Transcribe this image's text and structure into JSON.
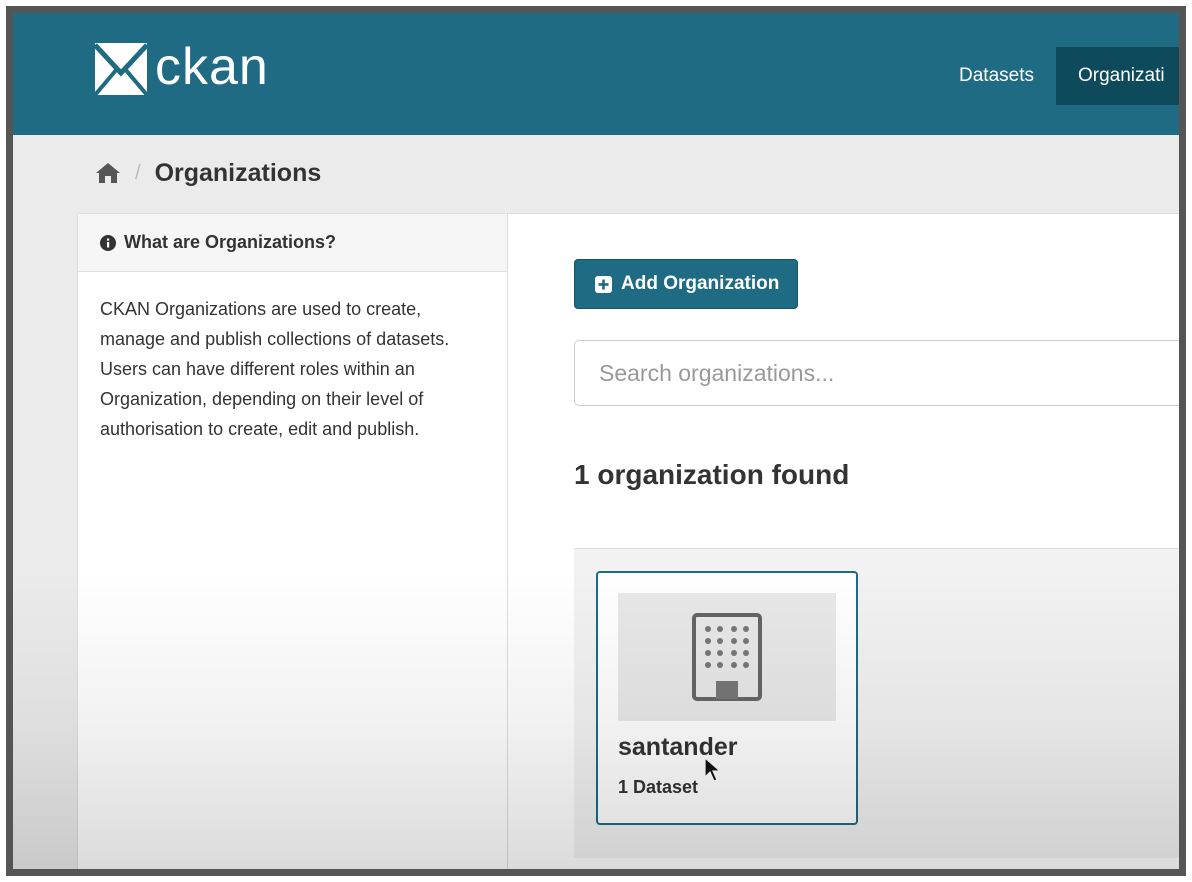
{
  "header": {
    "logo_text": "ckan",
    "nav": [
      {
        "label": "Datasets"
      },
      {
        "label": "Organizati"
      }
    ]
  },
  "breadcrumb": {
    "home_icon": "home-icon",
    "current": "Organizations"
  },
  "sidebar": {
    "heading": "What are Organizations?",
    "info_icon": "info-circle-icon",
    "description": "CKAN Organizations are used to create, manage and publish collections of datasets. Users can have different roles within an Organization, depending on their level of authorisation to create, edit and publish."
  },
  "main": {
    "add_button_label": "Add Organization",
    "search": {
      "placeholder": "Search organizations...",
      "value": ""
    },
    "results_title": "1 organization found",
    "organizations": [
      {
        "name": "santander",
        "dataset_count": "1 Dataset",
        "image_icon": "building-icon"
      }
    ]
  },
  "colors": {
    "brand": "#1f6b83",
    "nav_active": "#0e4a5c"
  }
}
